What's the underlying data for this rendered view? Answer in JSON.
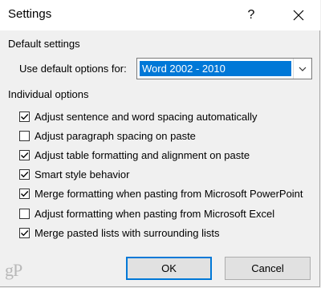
{
  "window": {
    "title": "Settings",
    "help_glyph": "?"
  },
  "default_settings": {
    "group_label": "Default settings",
    "use_label": "Use default options for:",
    "selected_value": "Word 2002 - 2010"
  },
  "individual": {
    "group_label": "Individual options",
    "options": [
      {
        "label": "Adjust sentence and word spacing automatically",
        "checked": true
      },
      {
        "label": "Adjust paragraph spacing on paste",
        "checked": false
      },
      {
        "label": "Adjust table formatting and alignment on paste",
        "checked": true
      },
      {
        "label": "Smart style behavior",
        "checked": true
      },
      {
        "label": "Merge formatting when pasting from Microsoft PowerPoint",
        "checked": true
      },
      {
        "label": "Adjust formatting when pasting from Microsoft Excel",
        "checked": false
      },
      {
        "label": "Merge pasted lists with surrounding lists",
        "checked": true
      }
    ]
  },
  "buttons": {
    "ok": "OK",
    "cancel": "Cancel"
  },
  "logo_text": "gP",
  "colors": {
    "accent": "#0078d7",
    "dialog_bg": "#f0f0f0",
    "button_bg": "#e1e1e1"
  }
}
